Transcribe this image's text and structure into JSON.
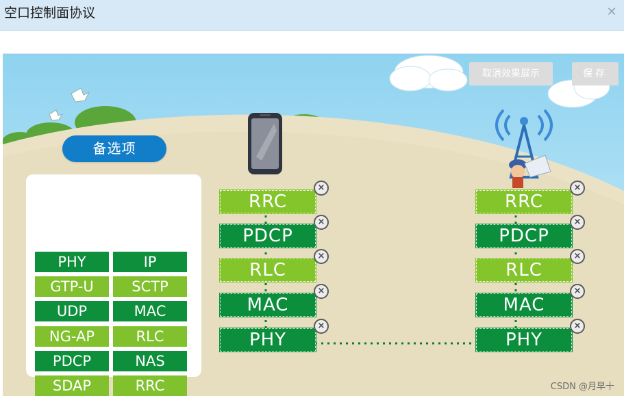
{
  "window": {
    "title": "空口控制面协议"
  },
  "toolbar": {
    "cancel_label": "取消效果展示",
    "save_label": "保存"
  },
  "options": {
    "title": "备选项",
    "items": [
      {
        "label": "PHY",
        "style": "dark"
      },
      {
        "label": "IP",
        "style": "dark"
      },
      {
        "label": "GTP-U",
        "style": "light"
      },
      {
        "label": "SCTP",
        "style": "light"
      },
      {
        "label": "UDP",
        "style": "dark"
      },
      {
        "label": "MAC",
        "style": "dark"
      },
      {
        "label": "NG-AP",
        "style": "light"
      },
      {
        "label": "RLC",
        "style": "light"
      },
      {
        "label": "PDCP",
        "style": "dark"
      },
      {
        "label": "NAS",
        "style": "dark"
      },
      {
        "label": "SDAP",
        "style": "light"
      },
      {
        "label": "RRC",
        "style": "light"
      }
    ]
  },
  "ue_stack": [
    {
      "label": "RRC",
      "style": "light"
    },
    {
      "label": "PDCP",
      "style": "dark"
    },
    {
      "label": "RLC",
      "style": "light"
    },
    {
      "label": "MAC",
      "style": "dark"
    },
    {
      "label": "PHY",
      "style": "dark"
    }
  ],
  "gnb_stack": [
    {
      "label": "RRC",
      "style": "light"
    },
    {
      "label": "PDCP",
      "style": "dark"
    },
    {
      "label": "RLC",
      "style": "light"
    },
    {
      "label": "MAC",
      "style": "dark"
    },
    {
      "label": "PHY",
      "style": "dark"
    }
  ],
  "remove_glyph": "×",
  "watermark": "CSDN @月早十",
  "colors": {
    "dark_green": "#0b8f3c",
    "light_green": "#84c52c",
    "pill_blue": "#127ec9"
  }
}
